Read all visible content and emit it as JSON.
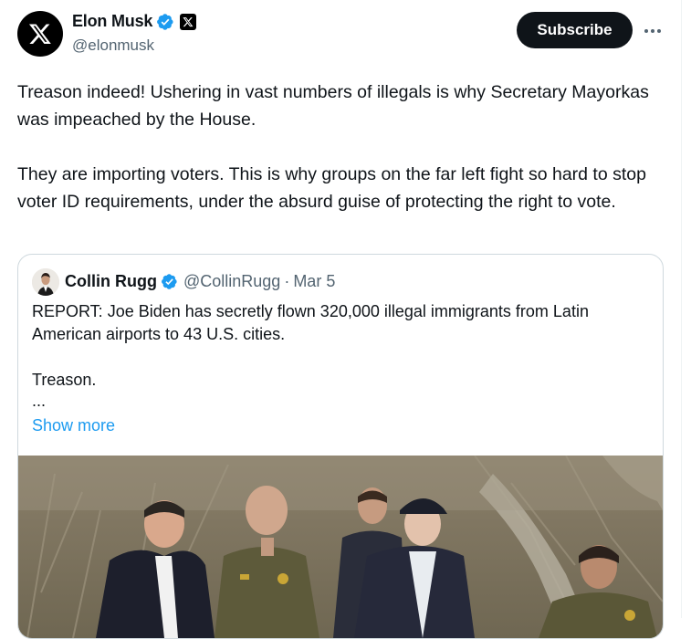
{
  "author": {
    "display_name": "Elon Musk",
    "handle": "@elonmusk",
    "avatar_icon": "x-logo-icon",
    "verified_color": "#1d9bf0"
  },
  "actions": {
    "subscribe_label": "Subscribe",
    "more_icon": "more-horizontal-icon"
  },
  "tweet": {
    "paragraphs": [
      "Treason indeed! Ushering in vast numbers of illegals is why Secretary Mayorkas was impeached by the House.",
      "They are importing voters. This is why groups on the far left fight so hard to stop voter ID requirements, under the absurd guise of protecting the right to vote."
    ]
  },
  "quote": {
    "display_name": "Collin Rugg",
    "handle": "@CollinRugg",
    "separator": "·",
    "date": "Mar 5",
    "paragraphs": [
      "REPORT: Joe Biden has secretly flown 320,000 illegal immigrants from Latin American airports to 43 U.S. cities.",
      "Treason."
    ],
    "ellipsis": "...",
    "show_more": "Show more",
    "media_description_icon": "video-thumbnail"
  },
  "colors": {
    "text": "#0f1419",
    "secondary": "#536471",
    "link": "#1d9bf0",
    "border": "#cfd9de",
    "button_bg": "#0f1419"
  }
}
